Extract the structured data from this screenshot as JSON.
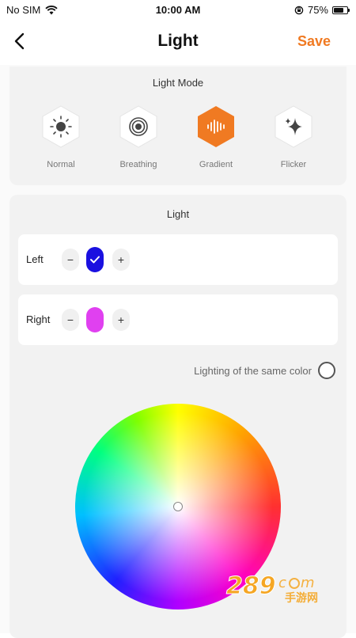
{
  "status_bar": {
    "carrier": "No SIM",
    "time": "10:00 AM",
    "battery_percent": "75%",
    "battery_level": 0.75,
    "icons": [
      "wifi-icon",
      "rotation-lock-icon",
      "battery-icon"
    ]
  },
  "nav": {
    "back_icon": "chevron-left-icon",
    "title": "Light",
    "save_label": "Save",
    "accent_color": "#f07a22"
  },
  "light_mode": {
    "title": "Light Mode",
    "modes": [
      {
        "label": "Normal",
        "icon": "sun-icon",
        "selected": false
      },
      {
        "label": "Breathing",
        "icon": "concentric-circles-icon",
        "selected": false
      },
      {
        "label": "Gradient",
        "icon": "sound-wave-icon",
        "selected": true
      },
      {
        "label": "Flicker",
        "icon": "sparkle-icon",
        "selected": false
      }
    ],
    "selected_color": "#f07a22"
  },
  "light": {
    "title": "Light",
    "left": {
      "label": "Left",
      "minus": "−",
      "plus": "+",
      "color": "#1a10e0",
      "checked": true
    },
    "right": {
      "label": "Right",
      "minus": "−",
      "plus": "+",
      "color": "#e040f0",
      "checked": false
    },
    "same_color_label": "Lighting of the same color",
    "same_color_checked": false,
    "color_wheel_icon": "color-wheel"
  },
  "watermark": {
    "text": "289",
    "subtext": "手游网"
  }
}
